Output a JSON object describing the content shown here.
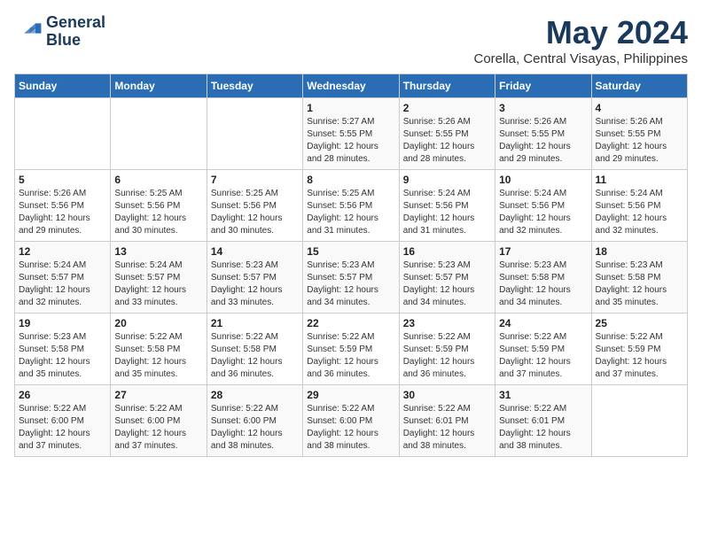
{
  "logo": {
    "line1": "General",
    "line2": "Blue"
  },
  "title": "May 2024",
  "subtitle": "Corella, Central Visayas, Philippines",
  "weekdays": [
    "Sunday",
    "Monday",
    "Tuesday",
    "Wednesday",
    "Thursday",
    "Friday",
    "Saturday"
  ],
  "weeks": [
    [
      {
        "day": "",
        "info": ""
      },
      {
        "day": "",
        "info": ""
      },
      {
        "day": "",
        "info": ""
      },
      {
        "day": "1",
        "info": "Sunrise: 5:27 AM\nSunset: 5:55 PM\nDaylight: 12 hours\nand 28 minutes."
      },
      {
        "day": "2",
        "info": "Sunrise: 5:26 AM\nSunset: 5:55 PM\nDaylight: 12 hours\nand 28 minutes."
      },
      {
        "day": "3",
        "info": "Sunrise: 5:26 AM\nSunset: 5:55 PM\nDaylight: 12 hours\nand 29 minutes."
      },
      {
        "day": "4",
        "info": "Sunrise: 5:26 AM\nSunset: 5:55 PM\nDaylight: 12 hours\nand 29 minutes."
      }
    ],
    [
      {
        "day": "5",
        "info": "Sunrise: 5:26 AM\nSunset: 5:56 PM\nDaylight: 12 hours\nand 29 minutes."
      },
      {
        "day": "6",
        "info": "Sunrise: 5:25 AM\nSunset: 5:56 PM\nDaylight: 12 hours\nand 30 minutes."
      },
      {
        "day": "7",
        "info": "Sunrise: 5:25 AM\nSunset: 5:56 PM\nDaylight: 12 hours\nand 30 minutes."
      },
      {
        "day": "8",
        "info": "Sunrise: 5:25 AM\nSunset: 5:56 PM\nDaylight: 12 hours\nand 31 minutes."
      },
      {
        "day": "9",
        "info": "Sunrise: 5:24 AM\nSunset: 5:56 PM\nDaylight: 12 hours\nand 31 minutes."
      },
      {
        "day": "10",
        "info": "Sunrise: 5:24 AM\nSunset: 5:56 PM\nDaylight: 12 hours\nand 32 minutes."
      },
      {
        "day": "11",
        "info": "Sunrise: 5:24 AM\nSunset: 5:56 PM\nDaylight: 12 hours\nand 32 minutes."
      }
    ],
    [
      {
        "day": "12",
        "info": "Sunrise: 5:24 AM\nSunset: 5:57 PM\nDaylight: 12 hours\nand 32 minutes."
      },
      {
        "day": "13",
        "info": "Sunrise: 5:24 AM\nSunset: 5:57 PM\nDaylight: 12 hours\nand 33 minutes."
      },
      {
        "day": "14",
        "info": "Sunrise: 5:23 AM\nSunset: 5:57 PM\nDaylight: 12 hours\nand 33 minutes."
      },
      {
        "day": "15",
        "info": "Sunrise: 5:23 AM\nSunset: 5:57 PM\nDaylight: 12 hours\nand 34 minutes."
      },
      {
        "day": "16",
        "info": "Sunrise: 5:23 AM\nSunset: 5:57 PM\nDaylight: 12 hours\nand 34 minutes."
      },
      {
        "day": "17",
        "info": "Sunrise: 5:23 AM\nSunset: 5:58 PM\nDaylight: 12 hours\nand 34 minutes."
      },
      {
        "day": "18",
        "info": "Sunrise: 5:23 AM\nSunset: 5:58 PM\nDaylight: 12 hours\nand 35 minutes."
      }
    ],
    [
      {
        "day": "19",
        "info": "Sunrise: 5:23 AM\nSunset: 5:58 PM\nDaylight: 12 hours\nand 35 minutes."
      },
      {
        "day": "20",
        "info": "Sunrise: 5:22 AM\nSunset: 5:58 PM\nDaylight: 12 hours\nand 35 minutes."
      },
      {
        "day": "21",
        "info": "Sunrise: 5:22 AM\nSunset: 5:58 PM\nDaylight: 12 hours\nand 36 minutes."
      },
      {
        "day": "22",
        "info": "Sunrise: 5:22 AM\nSunset: 5:59 PM\nDaylight: 12 hours\nand 36 minutes."
      },
      {
        "day": "23",
        "info": "Sunrise: 5:22 AM\nSunset: 5:59 PM\nDaylight: 12 hours\nand 36 minutes."
      },
      {
        "day": "24",
        "info": "Sunrise: 5:22 AM\nSunset: 5:59 PM\nDaylight: 12 hours\nand 37 minutes."
      },
      {
        "day": "25",
        "info": "Sunrise: 5:22 AM\nSunset: 5:59 PM\nDaylight: 12 hours\nand 37 minutes."
      }
    ],
    [
      {
        "day": "26",
        "info": "Sunrise: 5:22 AM\nSunset: 6:00 PM\nDaylight: 12 hours\nand 37 minutes."
      },
      {
        "day": "27",
        "info": "Sunrise: 5:22 AM\nSunset: 6:00 PM\nDaylight: 12 hours\nand 37 minutes."
      },
      {
        "day": "28",
        "info": "Sunrise: 5:22 AM\nSunset: 6:00 PM\nDaylight: 12 hours\nand 38 minutes."
      },
      {
        "day": "29",
        "info": "Sunrise: 5:22 AM\nSunset: 6:00 PM\nDaylight: 12 hours\nand 38 minutes."
      },
      {
        "day": "30",
        "info": "Sunrise: 5:22 AM\nSunset: 6:01 PM\nDaylight: 12 hours\nand 38 minutes."
      },
      {
        "day": "31",
        "info": "Sunrise: 5:22 AM\nSunset: 6:01 PM\nDaylight: 12 hours\nand 38 minutes."
      },
      {
        "day": "",
        "info": ""
      }
    ]
  ]
}
